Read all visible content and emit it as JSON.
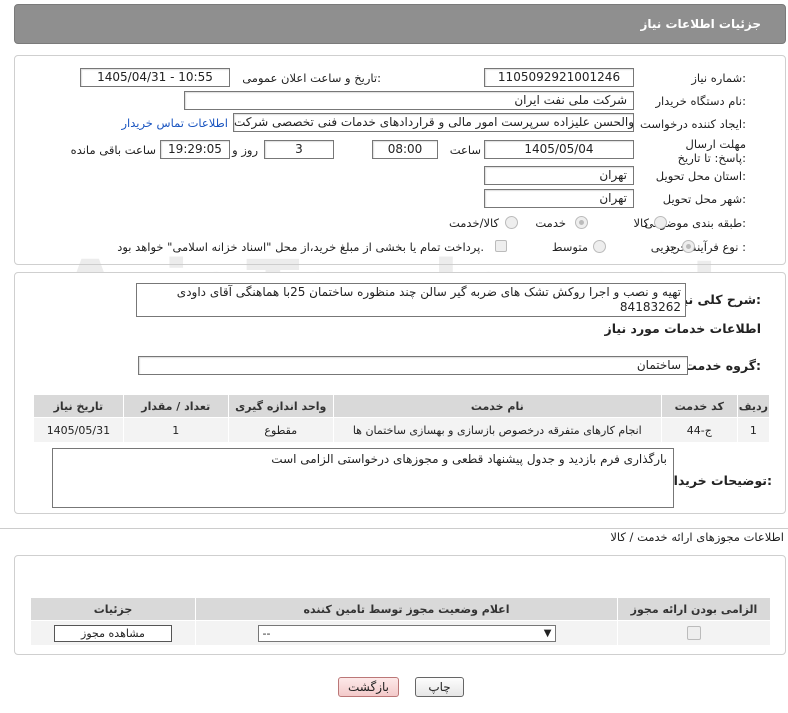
{
  "header": {
    "title": "جزئیات اطلاعات نیاز"
  },
  "fields": {
    "need_number_label": "شماره نیاز:",
    "need_number": "1105092921001246",
    "announce_label": "تاریخ و ساعت اعلان عمومی:",
    "announce_value": "1405/04/31 - 10:55",
    "buyer_org_label": "نام دستگاه خریدار:",
    "buyer_org": "شرکت ملی نفت ایران",
    "creator_label": "ایجاد کننده درخواست:",
    "creator": "ابوالحسن علیزاده سرپرست امور مالی و قراردادهای خدمات فنی تخصصی شرکت",
    "contact_link": "اطلاعات تماس خریدار",
    "deadline_label": "مهلت ارسال پاسخ: تا تاریخ:",
    "deadline_date": "1405/05/04",
    "time_label": "ساعت",
    "deadline_time": "08:00",
    "days": "3",
    "days_label": "روز و",
    "remaining_time": "19:29:05",
    "remaining_label": "ساعت باقی مانده",
    "province_label": "استان محل تحویل:",
    "province": "تهران",
    "city_label": "شهر محل تحویل:",
    "city": "تهران",
    "category_label": "طبقه بندی موضوعی:",
    "category_options": [
      "کالا",
      "خدمت",
      "کالا/خدمت"
    ],
    "process_label": "نوع فرآیند خرید :",
    "process_options": [
      "جزیی",
      "متوسط"
    ],
    "payment_note": "پرداخت تمام یا بخشی از مبلغ خرید،از محل \"اسناد خزانه اسلامی\" خواهد بود."
  },
  "watermark": "AriaTender.net",
  "summary": {
    "label": "شرح کلی نیاز:",
    "text": "تهیه و نصب و اجرا روکش تشک های ضربه گیر سالن چند منظوره ساختمان 25با هماهنگی آقای داودی 84183262"
  },
  "services": {
    "section_title": "اطلاعات خدمات مورد نیاز",
    "group_label": "گروه خدمت:",
    "group_value": "ساختمان",
    "columns": [
      "ردیف",
      "کد خدمت",
      "نام خدمت",
      "واحد اندازه گیری",
      "تعداد / مقدار",
      "تاریخ نیاز"
    ],
    "rows": [
      [
        "1",
        "ج-44",
        "انجام کارهای متفرقه درخصوص بازسازی و بهسازی ساختمان ها",
        "مقطوع",
        "1",
        "1405/05/31"
      ]
    ]
  },
  "buyer_notes": {
    "label": "توضیحات خریدار:",
    "text": "بارگذاری فرم بازدید و جدول پیشنهاد قطعی و مجوزهای درخواستی الزامی است"
  },
  "permits": {
    "title": "اطلاعات مجوزهای ارائه خدمت / کالا",
    "columns": [
      "الزامی بودن ارائه مجوز",
      "اعلام وضعیت مجوز توسط تامین کننده",
      "جزئیات"
    ],
    "select_value": "--",
    "view_button": "مشاهده مجوز"
  },
  "buttons": {
    "print": "چاپ",
    "back": "بازگشت"
  }
}
